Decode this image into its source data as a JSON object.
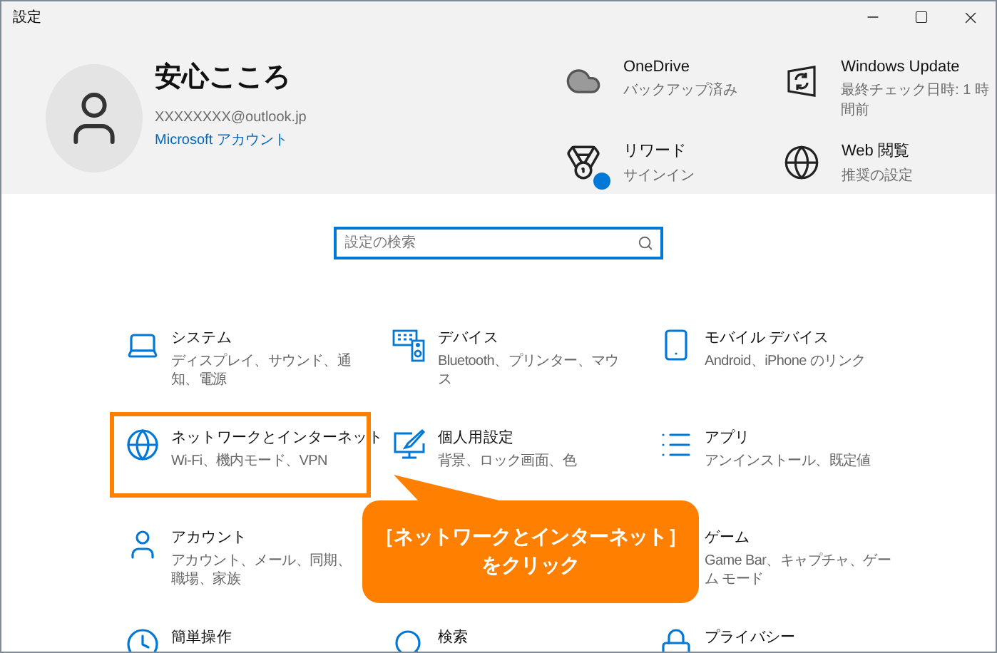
{
  "window": {
    "title": "設定"
  },
  "account": {
    "name": "安心こころ",
    "email": "XXXXXXXX@outlook.jp",
    "link": "Microsoft アカウント"
  },
  "status_items": [
    {
      "title": "OneDrive",
      "subtitle": "バックアップ済み"
    },
    {
      "title": "Windows Update",
      "subtitle": "最終チェック日時: 1 時間前"
    },
    {
      "title": "リワード",
      "subtitle": "サインイン",
      "color": "#0078d7"
    },
    {
      "title": "Web 閲覧",
      "subtitle": "推奨の設定"
    }
  ],
  "search": {
    "placeholder": "設定の検索"
  },
  "rows": [
    {
      "tiles": [
        {
          "title": "システム",
          "subtitle": "ディスプレイ、サウンド、通知、電源",
          "selected": false
        },
        {
          "title": "デバイス",
          "subtitle": "Bluetooth、プリンター、マウス",
          "selected": false
        },
        {
          "title": "モバイル デバイス",
          "subtitle": "Android、iPhone のリンク",
          "selected": false
        }
      ]
    },
    {
      "tiles": [
        {
          "title": "ネットワークとインターネット",
          "subtitle": "Wi-Fi、機内モード、VPN",
          "selected": true
        },
        {
          "title": "個人用設定",
          "subtitle": "背景、ロック画面、色",
          "selected": false
        },
        {
          "title": "アプリ",
          "subtitle": "アンインストール、既定値",
          "selected": false
        }
      ]
    },
    {
      "tiles": [
        {
          "title": "アカウント",
          "subtitle": "アカウント、メール、同期、職場、家族",
          "selected": false
        },
        {
          "title": "ゲーム",
          "subtitle": "Game Bar、キャプチャ、ゲーム モード",
          "selected": false
        }
      ]
    },
    {
      "tiles": [
        {
          "title": "簡単操作",
          "selected": false
        },
        {
          "title": "検索",
          "selected": false
        },
        {
          "title": "プライバシー",
          "selected": false
        }
      ]
    }
  ],
  "callout": {
    "lines": [
      "［ネットワークとインターネット］",
      "をクリック"
    ]
  }
}
